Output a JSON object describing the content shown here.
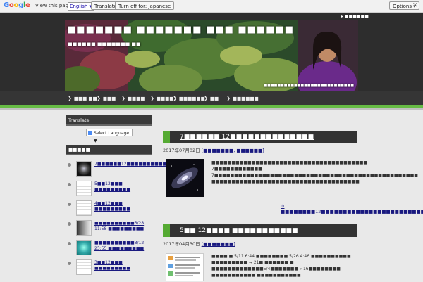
{
  "translate_bar": {
    "logo": "Google",
    "prompt": "View this page in:",
    "language": "English",
    "translate_label": "Translate",
    "turn_off_label": "Turn off for: Japanese",
    "options_label": "Options ▾",
    "close": "✕"
  },
  "header": {
    "top_link": "▸ ■■■■■■",
    "title": "■■■■■■■ ■■■■■■■ ■■■ ■■■■■■",
    "subtitle": "■■■■■■ ■■■■■■■ ■■",
    "caption": "■■■■■■■■■■■■■■■■■■■■■■■■■■■"
  },
  "nav": {
    "items": [
      "■■■ ■■",
      "■■■",
      "■■■■",
      "■■■■",
      "■■■■■■",
      "■■",
      "■■■■■■"
    ]
  },
  "sidebar": {
    "translate_heading": "Translate",
    "select_language": "Select Language ▼",
    "recent_heading": "■■■■■",
    "items": [
      {
        "text": "7■■■■■■12■■■■■■■■■■■■■■■■",
        "thumb": "galaxy"
      },
      {
        "text": "5■■12■■■ ■■■■■■■■■",
        "thumb": "doc"
      },
      {
        "text": "4■■12■■■ ■■■■■■■■■",
        "thumb": "doc"
      },
      {
        "text": "■■■■■■■■■■3/28 11:58 ■■■■■■■■■",
        "thumb": "gradient"
      },
      {
        "text": "■■■■■■■■■■3/12 23:55 ■■■■■■■■■",
        "thumb": "teal"
      },
      {
        "text": "3■■12■■■ ■■■■■■■■■",
        "thumb": "doc"
      }
    ]
  },
  "posts": [
    {
      "title": "7■■■■■■ 12■■■■■■■■■■■■■■",
      "date": "2017年07月02日",
      "tags": "[■■■■■■■, ■■■■■■]",
      "body": "■■■■■■■■■■■■■■■■■■■■■■■■■■■■■■■■■■■■■■■ 7■■■■■■■■■■■■  7■■■■■■■■■■■■■■■■■■■■■■■■■■■■■■■■■■■■■■■■■■■■■■■■■■■ ■■■■■■■■■■■■■■■■■■■■■■■■■■■■■■■■■■■■■",
      "more": "⊙ ■■■■■■■■12■■■■■■■■■■■■■■■■■■■■■■■■■■■■"
    },
    {
      "title": "5■■ 12■■■■ ■■■■■■■■■■■",
      "date": "2017年04月30日",
      "tags": "[■■■■■■■]",
      "body": "■■■■ ■ 5/11 6:44 ■■■■■■■■ 5/26 4:46 ■■■■■■■■■■ ■■■■■■■■■ → 21■ ■■■■■■ ■ ■■■■■■■■■■■■■5/4■■■■■■■→ 16■■■■■■■■ ■■■■■■■■■■■ ■■■■■■■■■■■"
    }
  ]
}
